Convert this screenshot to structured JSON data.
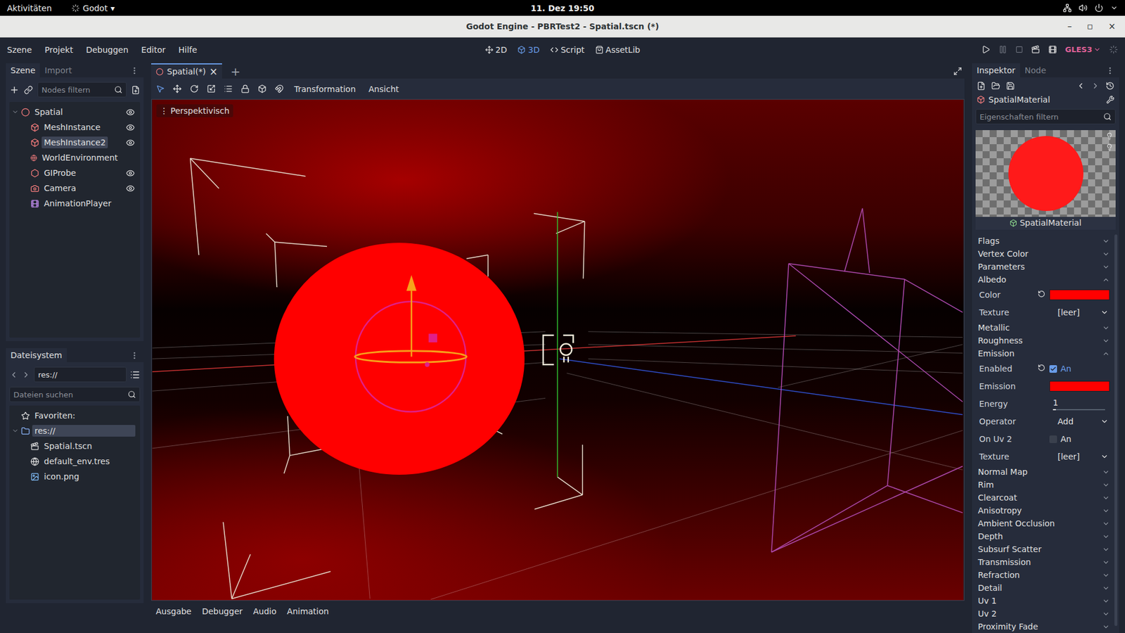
{
  "system_bar": {
    "activities": "Aktivitäten",
    "app": "Godot",
    "app_arrow": "▾",
    "clock": "11. Dez 19:50"
  },
  "window": {
    "title": "Godot Engine - PBRTest2 - Spatial.tscn (*)",
    "controls": [
      "–",
      "▫",
      "×"
    ]
  },
  "menu": [
    "Szene",
    "Projekt",
    "Debuggen",
    "Editor",
    "Hilfe"
  ],
  "workspaces": [
    {
      "label": "2D",
      "selected": false
    },
    {
      "label": "3D",
      "selected": true
    },
    {
      "label": "Script",
      "selected": false
    },
    {
      "label": "AssetLib",
      "selected": false
    }
  ],
  "renderer": "GLES3",
  "scene_dock": {
    "tabs": [
      {
        "label": "Szene",
        "selected": true
      },
      {
        "label": "Import",
        "selected": false
      }
    ],
    "filter_placeholder": "Nodes filtern",
    "nodes": [
      {
        "name": "Spatial",
        "kind": "spatial",
        "depth": 0,
        "expanded": true,
        "selected": false,
        "eye": true,
        "color": "#fc7f7f"
      },
      {
        "name": "MeshInstance",
        "kind": "mesh",
        "depth": 1,
        "selected": false,
        "eye": true,
        "color": "#fc7f7f"
      },
      {
        "name": "MeshInstance2",
        "kind": "mesh",
        "depth": 1,
        "selected": true,
        "eye": true,
        "color": "#fc7f7f"
      },
      {
        "name": "WorldEnvironment",
        "kind": "environment",
        "depth": 1,
        "selected": false,
        "eye": false,
        "color": "#fc7f7f"
      },
      {
        "name": "GIProbe",
        "kind": "probe",
        "depth": 1,
        "selected": false,
        "eye": true,
        "color": "#fc7f7f"
      },
      {
        "name": "Camera",
        "kind": "camera",
        "depth": 1,
        "selected": false,
        "eye": true,
        "color": "#fc7f7f"
      },
      {
        "name": "AnimationPlayer",
        "kind": "animation",
        "depth": 1,
        "selected": false,
        "eye": false,
        "color": "#c38ef1"
      }
    ]
  },
  "filesystem": {
    "tabs": [
      {
        "label": "Dateisystem",
        "selected": true
      }
    ],
    "path": "res://",
    "search_placeholder": "Dateien suchen",
    "items": [
      {
        "name": "Favoriten:",
        "kind": "favorites",
        "depth": 0,
        "selected": false
      },
      {
        "name": "res://",
        "kind": "folder",
        "depth": 0,
        "expanded": true,
        "selected": true
      },
      {
        "name": "Spatial.tscn",
        "kind": "scene",
        "depth": 1,
        "selected": false
      },
      {
        "name": "default_env.tres",
        "kind": "environment",
        "depth": 1,
        "selected": false
      },
      {
        "name": "icon.png",
        "kind": "image",
        "depth": 1,
        "selected": false
      }
    ]
  },
  "editor": {
    "tabs": [
      {
        "label": "Spatial(*)",
        "selected": true,
        "close": "×"
      }
    ],
    "new_tab": "+",
    "toolbar_menus": [
      "Transformation",
      "Ansicht"
    ],
    "viewport": {
      "menu_glyph": "⋮",
      "label": "Perspektivisch"
    }
  },
  "bottom_tabs": [
    {
      "label": "Ausgabe",
      "selected": false
    },
    {
      "label": "Debugger",
      "selected": false
    },
    {
      "label": "Audio",
      "selected": false
    },
    {
      "label": "Animation",
      "selected": false
    }
  ],
  "inspector": {
    "tabs": [
      {
        "label": "Inspektor",
        "selected": true
      },
      {
        "label": "Node",
        "selected": false
      }
    ],
    "resource": "SpatialMaterial",
    "filter_placeholder": "Eigenschaften filtern",
    "preview_caption": "SpatialMaterial",
    "rows": [
      {
        "kind": "section",
        "label": "Flags",
        "expanded": false
      },
      {
        "kind": "section",
        "label": "Vertex Color",
        "expanded": false
      },
      {
        "kind": "section",
        "label": "Parameters",
        "expanded": false
      },
      {
        "kind": "section",
        "label": "Albedo",
        "expanded": true
      },
      {
        "kind": "color",
        "label": "Color",
        "color": "#ff0000",
        "revert": true
      },
      {
        "kind": "resource",
        "label": "Texture",
        "value": "[leer]",
        "revert": false
      },
      {
        "kind": "section",
        "label": "Metallic",
        "expanded": false
      },
      {
        "kind": "section",
        "label": "Roughness",
        "expanded": false
      },
      {
        "kind": "section",
        "label": "Emission",
        "expanded": true
      },
      {
        "kind": "check",
        "label": "Enabled",
        "checked": true,
        "text": "An",
        "revert": true
      },
      {
        "kind": "color",
        "label": "Emission",
        "color": "#ff0000",
        "revert": false
      },
      {
        "kind": "number",
        "label": "Energy",
        "value": "1",
        "level": 0.06,
        "revert": false
      },
      {
        "kind": "enum",
        "label": "Operator",
        "value": "Add",
        "revert": false
      },
      {
        "kind": "check",
        "label": "On Uv 2",
        "checked": false,
        "text": "An",
        "revert": false
      },
      {
        "kind": "resource",
        "label": "Texture",
        "value": "[leer]",
        "revert": false
      },
      {
        "kind": "section",
        "label": "Normal Map",
        "expanded": false
      },
      {
        "kind": "section",
        "label": "Rim",
        "expanded": false
      },
      {
        "kind": "section",
        "label": "Clearcoat",
        "expanded": false
      },
      {
        "kind": "section",
        "label": "Anisotropy",
        "expanded": false
      },
      {
        "kind": "section",
        "label": "Ambient Occlusion",
        "expanded": false
      },
      {
        "kind": "section",
        "label": "Depth",
        "expanded": false
      },
      {
        "kind": "section",
        "label": "Subsurf Scatter",
        "expanded": false
      },
      {
        "kind": "section",
        "label": "Transmission",
        "expanded": false
      },
      {
        "kind": "section",
        "label": "Refraction",
        "expanded": false
      },
      {
        "kind": "section",
        "label": "Detail",
        "expanded": false
      },
      {
        "kind": "section",
        "label": "Uv 1",
        "expanded": false
      },
      {
        "kind": "section",
        "label": "Uv 2",
        "expanded": false
      },
      {
        "kind": "section",
        "label": "Proximity Fade",
        "expanded": false
      }
    ]
  }
}
